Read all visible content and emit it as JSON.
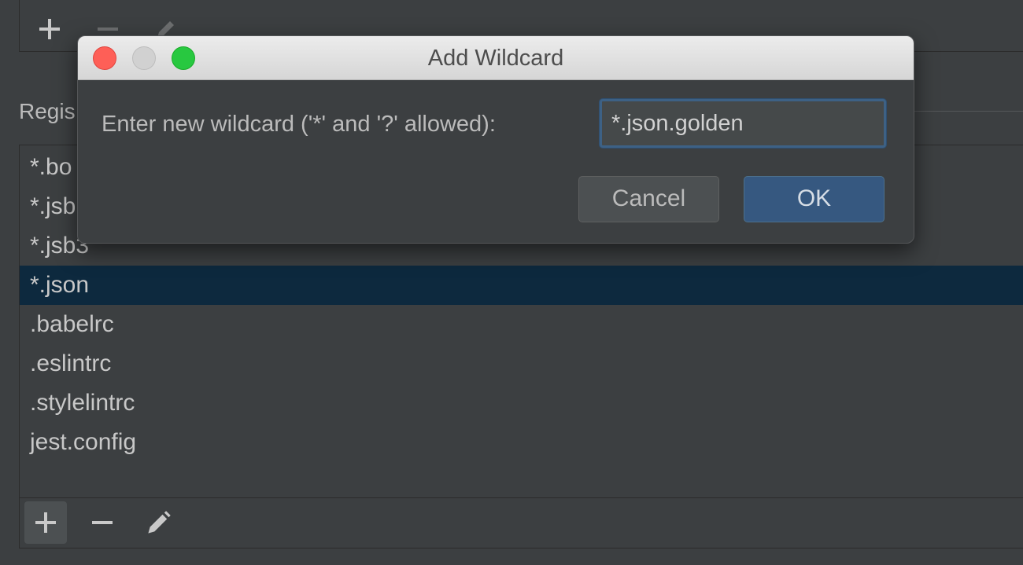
{
  "top_toolbar": {
    "add_icon": "plus-icon",
    "remove_icon": "minus-icon",
    "edit_icon": "pencil-icon"
  },
  "section": {
    "label": "Regis"
  },
  "list": {
    "items": [
      {
        "label": "*.bo",
        "selected": false
      },
      {
        "label": "*.jsb",
        "selected": false
      },
      {
        "label": "*.jsb3",
        "selected": false
      },
      {
        "label": "*.json",
        "selected": true
      },
      {
        "label": ".babelrc",
        "selected": false
      },
      {
        "label": ".eslintrc",
        "selected": false
      },
      {
        "label": ".stylelintrc",
        "selected": false
      },
      {
        "label": "jest.config",
        "selected": false
      }
    ]
  },
  "footer_toolbar": {
    "add_icon": "plus-icon",
    "remove_icon": "minus-icon",
    "edit_icon": "pencil-icon"
  },
  "dialog": {
    "title": "Add Wildcard",
    "prompt": "Enter new wildcard ('*' and '?' allowed):",
    "input_value": "*.json.golden",
    "cancel_label": "Cancel",
    "ok_label": "OK"
  },
  "colors": {
    "background": "#3c3f41",
    "selection": "#0d293e",
    "ok_button": "#365880",
    "focus_ring": "#3d6185",
    "close": "#fe5f57",
    "minimize": "#d1d1d1",
    "zoom": "#28c840"
  }
}
